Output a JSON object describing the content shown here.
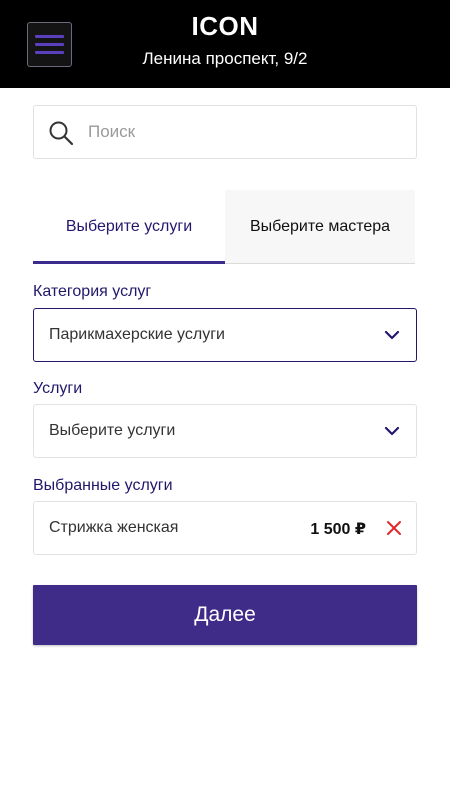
{
  "header": {
    "title": "ICON",
    "subtitle": "Ленина проспект, 9/2",
    "menu_icon": "hamburger-menu-icon"
  },
  "search": {
    "placeholder": "Поиск",
    "value": "",
    "icon": "search-icon"
  },
  "tabs": [
    {
      "label": "Выберите услуги",
      "active": true
    },
    {
      "label": "Выберите мастера",
      "active": false
    }
  ],
  "category": {
    "label": "Категория услуг",
    "selected": "Парикмахерские услуги"
  },
  "services": {
    "label": "Услуги",
    "selected": "Выберите услуги"
  },
  "selected_services": {
    "label": "Выбранные услуги",
    "items": [
      {
        "name": "Стрижка женская",
        "price": "1 500 ₽"
      }
    ]
  },
  "next_button": {
    "label": "Далее"
  },
  "colors": {
    "header_bg": "#000000",
    "accent": "#3f2b88",
    "label_text": "#22186b",
    "remove": "#e0282e"
  }
}
